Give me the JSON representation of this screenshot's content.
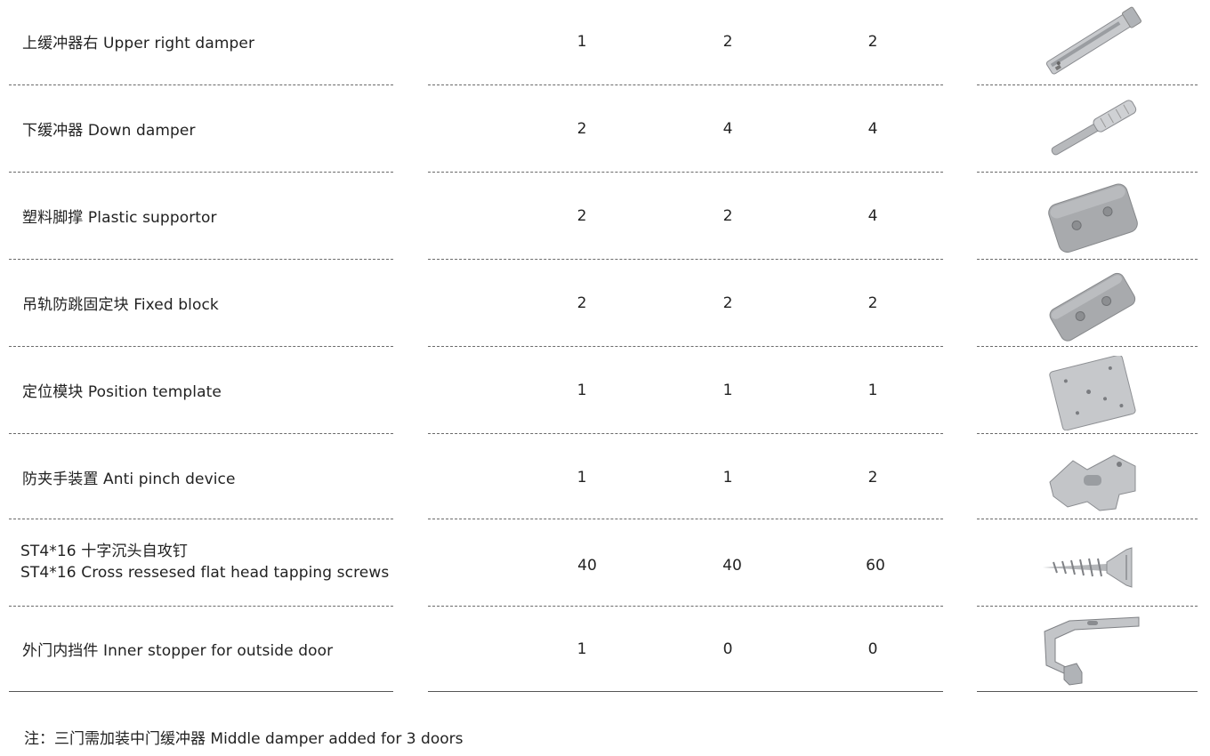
{
  "rows": [
    {
      "name": "上缓冲器右 Upper right damper",
      "q1": "1",
      "q2": "2",
      "q3": "2",
      "icon": "upper-damper-icon"
    },
    {
      "name": "下缓冲器 Down damper",
      "q1": "2",
      "q2": "4",
      "q3": "4",
      "icon": "down-damper-icon"
    },
    {
      "name": "塑料脚撑 Plastic supportor",
      "q1": "2",
      "q2": "2",
      "q3": "4",
      "icon": "plastic-support-icon"
    },
    {
      "name": "吊轨防跳固定块 Fixed block",
      "q1": "2",
      "q2": "2",
      "q3": "2",
      "icon": "fixed-block-icon"
    },
    {
      "name": "定位模块 Position template",
      "q1": "1",
      "q2": "1",
      "q3": "1",
      "icon": "position-template-icon"
    },
    {
      "name": "防夹手装置 Anti pinch device",
      "q1": "1",
      "q2": "1",
      "q3": "2",
      "icon": "anti-pinch-icon"
    },
    {
      "name_line1": "ST4*16 十字沉头自攻钉",
      "name_line2": "ST4*16 Cross ressesed flat head tapping screws",
      "q1": "40",
      "q2": "40",
      "q3": "60",
      "icon": "screw-icon"
    },
    {
      "name": "外门内挡件 Inner stopper for outside door",
      "q1": "1",
      "q2": "0",
      "q3": "0",
      "icon": "inner-stopper-icon"
    }
  ],
  "footnote": "注：三门需加装中门缓冲器 Middle damper added for 3 doors",
  "colors": {
    "text": "#222222",
    "rule": "#6a6a6a",
    "part_grey": "#b9bbbe"
  }
}
